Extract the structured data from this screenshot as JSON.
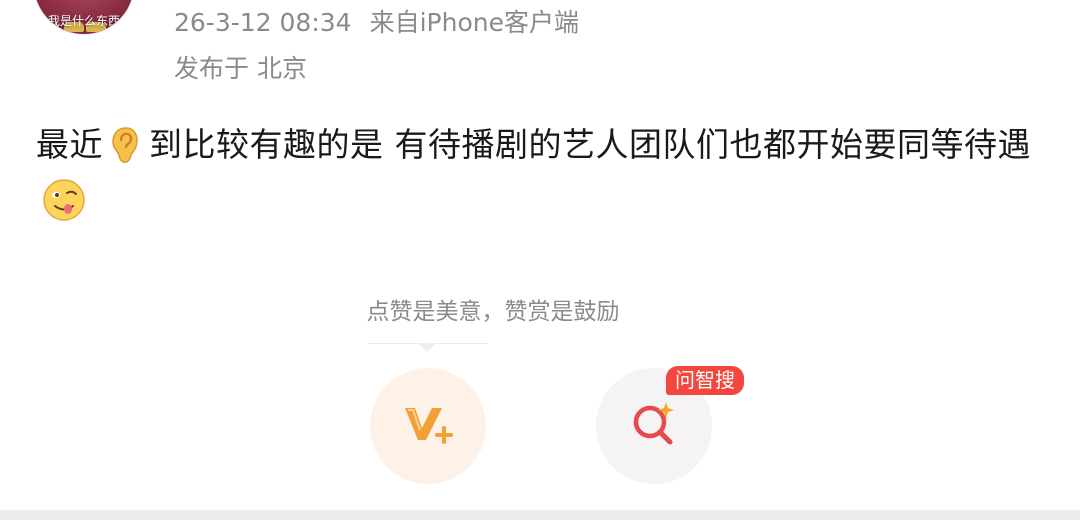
{
  "avatar": {
    "caption": "我是什么东西"
  },
  "meta": {
    "time": "26-3-12 08:34",
    "source": "来自iPhone客户端",
    "location": "发布于 北京"
  },
  "post": {
    "text_before_emoji": "最近",
    "emoji_1": "ear-emoji",
    "text_middle": "到比较有趣的是 有待播剧的艺人团队们也都开始要同等待遇",
    "emoji_2": "yummy-face-emoji"
  },
  "reward": {
    "tip": "点赞是美意，赞赏是鼓励",
    "icon": "v-plus-icon"
  },
  "search": {
    "badge": "问智搜",
    "icon": "sparkle-search-icon"
  },
  "colors": {
    "meta_gray": "#8a8a8a",
    "reward_orange": "#f2a033",
    "search_red": "#e64a4a",
    "badge_red": "#f2463e"
  }
}
